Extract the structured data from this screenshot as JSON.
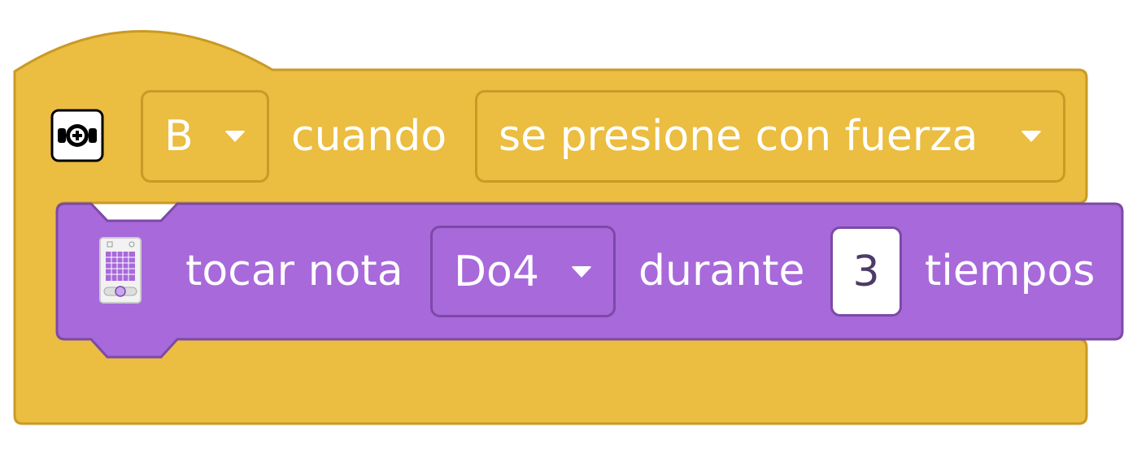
{
  "hat_block": {
    "button_select": "B",
    "when_label": "cuando",
    "event_select": "se presione con fuerza",
    "colors": {
      "fill": "#EBBD40",
      "stroke": "#C99A25"
    }
  },
  "command_block": {
    "action_label": "tocar nota",
    "note_select": "Do4",
    "duration_label": "durante",
    "beats_value": "3",
    "unit_label": "tiempos",
    "colors": {
      "fill": "#A869DB",
      "stroke": "#7C4AA6"
    }
  },
  "icons": {
    "hat": "force-sensor-icon",
    "command": "hub-speaker-icon"
  }
}
